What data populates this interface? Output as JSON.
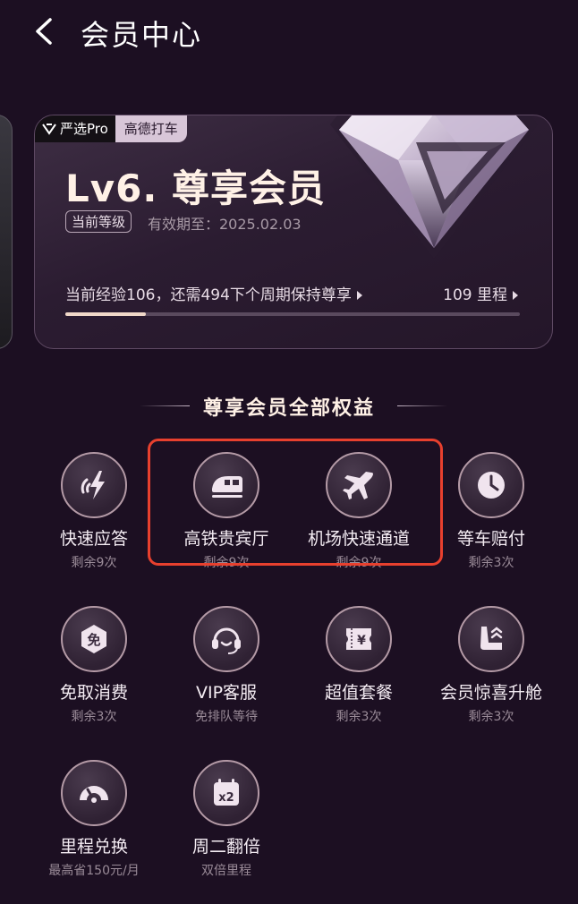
{
  "header": {
    "title": "会员中心"
  },
  "card": {
    "brand_pro": "严选Pro",
    "brand_amap": "高德打车",
    "level_title": "Lv6. 尊享会员",
    "level_badge": "当前等级",
    "validity": "有效期至：2025.02.03",
    "exp_text": "当前经验106，还需494下个周期保持尊享",
    "miles": "109 里程",
    "progress": 0.177
  },
  "section": {
    "title": "尊享会员全部权益"
  },
  "benefits": [
    {
      "name": "快速应答",
      "sub": "剩余9次",
      "icon": "fast-reply-icon"
    },
    {
      "name": "高铁贵宾厅",
      "sub": "剩余9次",
      "icon": "train-icon"
    },
    {
      "name": "机场快速通道",
      "sub": "剩余9次",
      "icon": "airplane-icon"
    },
    {
      "name": "等车赔付",
      "sub": "剩余3次",
      "icon": "clock-icon"
    },
    {
      "name": "免取消费",
      "sub": "剩余3次",
      "icon": "free-cancel-icon",
      "glyph": "免"
    },
    {
      "name": "VIP客服",
      "sub": "免排队等待",
      "icon": "headset-icon"
    },
    {
      "name": "超值套餐",
      "sub": "剩余3次",
      "icon": "coupon-icon",
      "glyph": "¥"
    },
    {
      "name": "会员惊喜升舱",
      "sub": "剩余3次",
      "icon": "seat-upgrade-icon"
    },
    {
      "name": "里程兑换",
      "sub": "最高省150元/月",
      "icon": "gauge-icon"
    },
    {
      "name": "周二翻倍",
      "sub": "双倍里程",
      "icon": "calendar-x2-icon",
      "glyph": "x2"
    }
  ],
  "colors": {
    "background": "#1c0f22",
    "highlight": "#e8402e",
    "accent": "#f0d8c8"
  }
}
